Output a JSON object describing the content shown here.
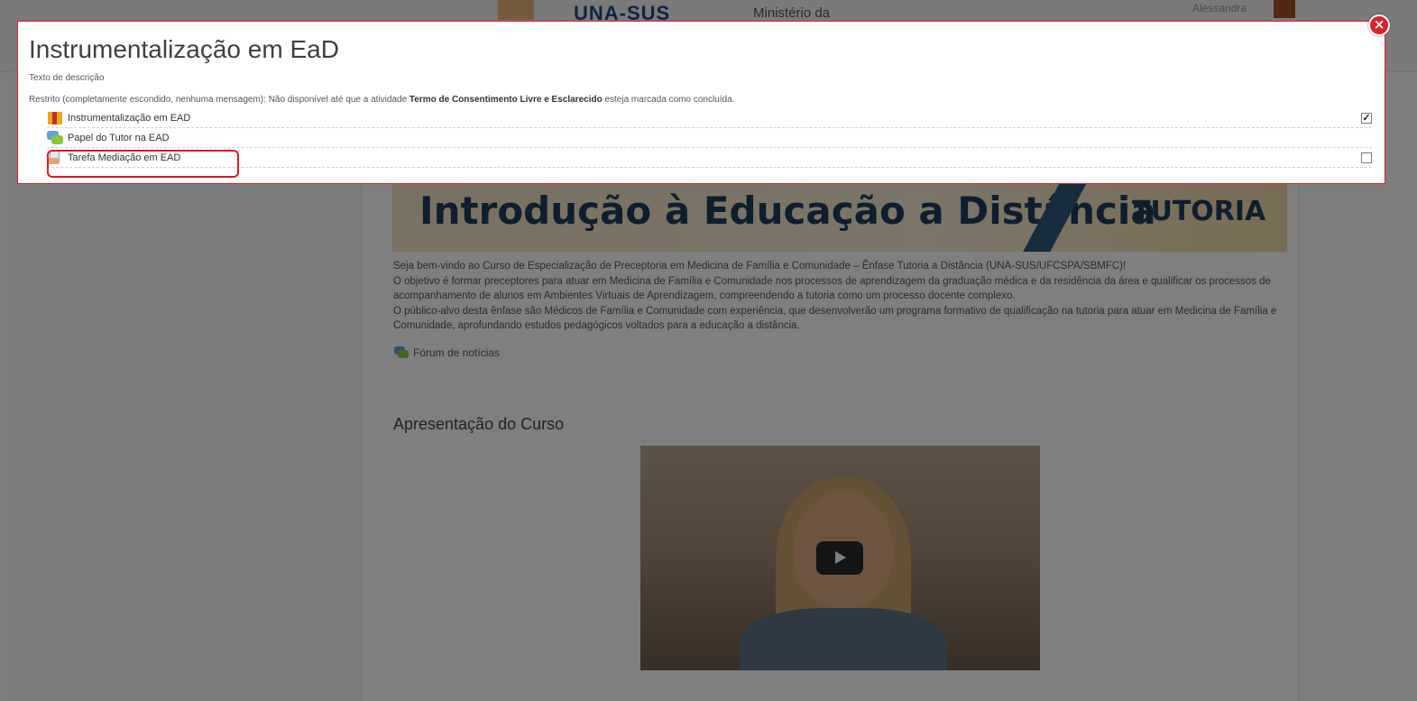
{
  "background": {
    "header": {
      "logo_text": "UNA-SUS",
      "ministry_text": "Ministério da",
      "user_text": "Alessandra"
    },
    "banner": {
      "title": "Introdução à Educação a Distância",
      "tag": "TUTORIA"
    },
    "intro_lines": [
      "Seja bem-vindo ao Curso de Especialização de Preceptoria em Medicina de Família e Comunidade – Ênfase Tutoria a Distância (UNA-SUS/UFCSPA/SBMFC)!",
      "O objetivo é formar preceptores para atuar em Medicina de Família e Comunidade nos processos de aprendizagem da graduação médica e da residência da área e qualificar os processos de acompanhamento de alunos em Ambientes Virtuais de Aprendizagem, compreendendo a tutoria como um processo docente complexo.",
      "O público-alvo desta ênfase são Médicos de Família e Comunidade com experiência, que desenvolverão um programa formativo de qualificação na tutoria para atuar em Medicina de Família e Comunidade, aprofundando estudos pedagógicos voltados para a educação a distância."
    ],
    "forum_link": "Fórum de notícias",
    "section_title": "Apresentação do Curso"
  },
  "modal": {
    "title": "Instrumentalização em EaD",
    "description": "Texto de descrição",
    "restriction_prefix": "Restrito (completamente escondido, nenhuma mensagem): Não disponível até que a atividade",
    "restriction_activity": "Termo de Consentimento Livre e Esclarecido",
    "restriction_suffix": "esteja marcada como concluída.",
    "close_symbol": "×",
    "activities": [
      {
        "label": "Instrumentalização em EAD",
        "icon": "package-icon",
        "completed": true,
        "check_mark": "✓"
      },
      {
        "label": "Papel do Tutor na EAD",
        "icon": "forum-icon",
        "completed": false
      },
      {
        "label": "Tarefa Mediação em EAD",
        "icon": "assignment-icon",
        "completed": false,
        "highlighted": true
      }
    ]
  },
  "colors": {
    "accent_red": "#e0182d",
    "overlay": "rgba(0,0,0,0.5)"
  }
}
